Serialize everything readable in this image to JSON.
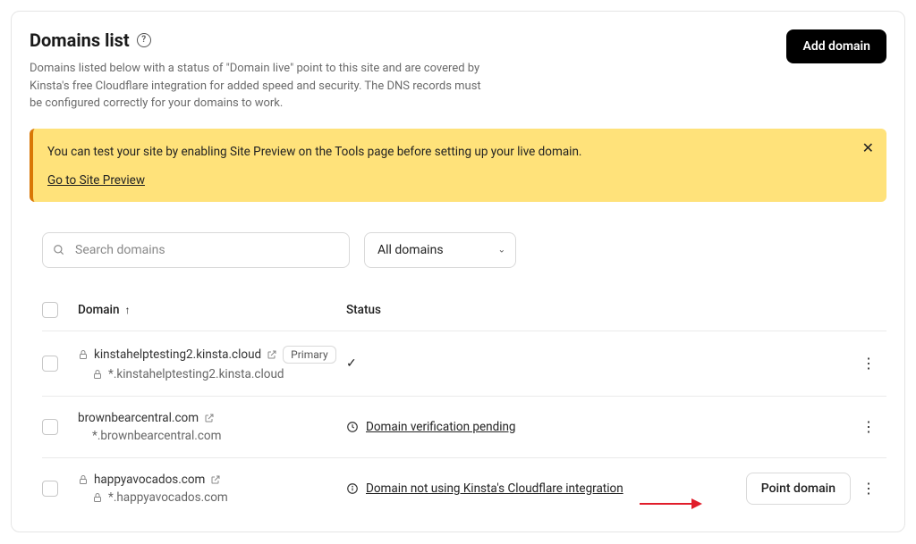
{
  "header": {
    "title": "Domains list",
    "subtitle": "Domains listed below with a status of \"Domain live\" point to this site and are covered by Kinsta's free Cloudflare integration for added speed and security. The DNS records must be configured correctly for your domains to work.",
    "add_button": "Add domain"
  },
  "alert": {
    "message": "You can test your site by enabling Site Preview on the Tools page before setting up your live domain.",
    "link": "Go to Site Preview"
  },
  "search": {
    "placeholder": "Search domains"
  },
  "filter": {
    "selected": "All domains"
  },
  "table": {
    "col_domain": "Domain",
    "col_status": "Status",
    "rows": [
      {
        "domain": "kinstahelptesting2.kinsta.cloud",
        "wildcard": "*.kinstahelptesting2.kinsta.cloud",
        "has_lock_domain": true,
        "has_lock_wild": true,
        "has_ext": true,
        "primary_badge": "Primary",
        "status_type": "check",
        "status_text": "",
        "point_button": "",
        "has_menu": true
      },
      {
        "domain": "brownbearcentral.com",
        "wildcard": "*.brownbearcentral.com",
        "has_lock_domain": false,
        "has_lock_wild": false,
        "has_ext": true,
        "primary_badge": "",
        "status_type": "clock",
        "status_text": "Domain verification pending",
        "point_button": "",
        "has_menu": true
      },
      {
        "domain": "happyavocados.com",
        "wildcard": "*.happyavocados.com",
        "has_lock_domain": true,
        "has_lock_wild": true,
        "has_ext": true,
        "primary_badge": "",
        "status_type": "info",
        "status_text": "Domain not using Kinsta's Cloudflare integration",
        "point_button": "Point domain",
        "has_menu": true
      }
    ]
  }
}
